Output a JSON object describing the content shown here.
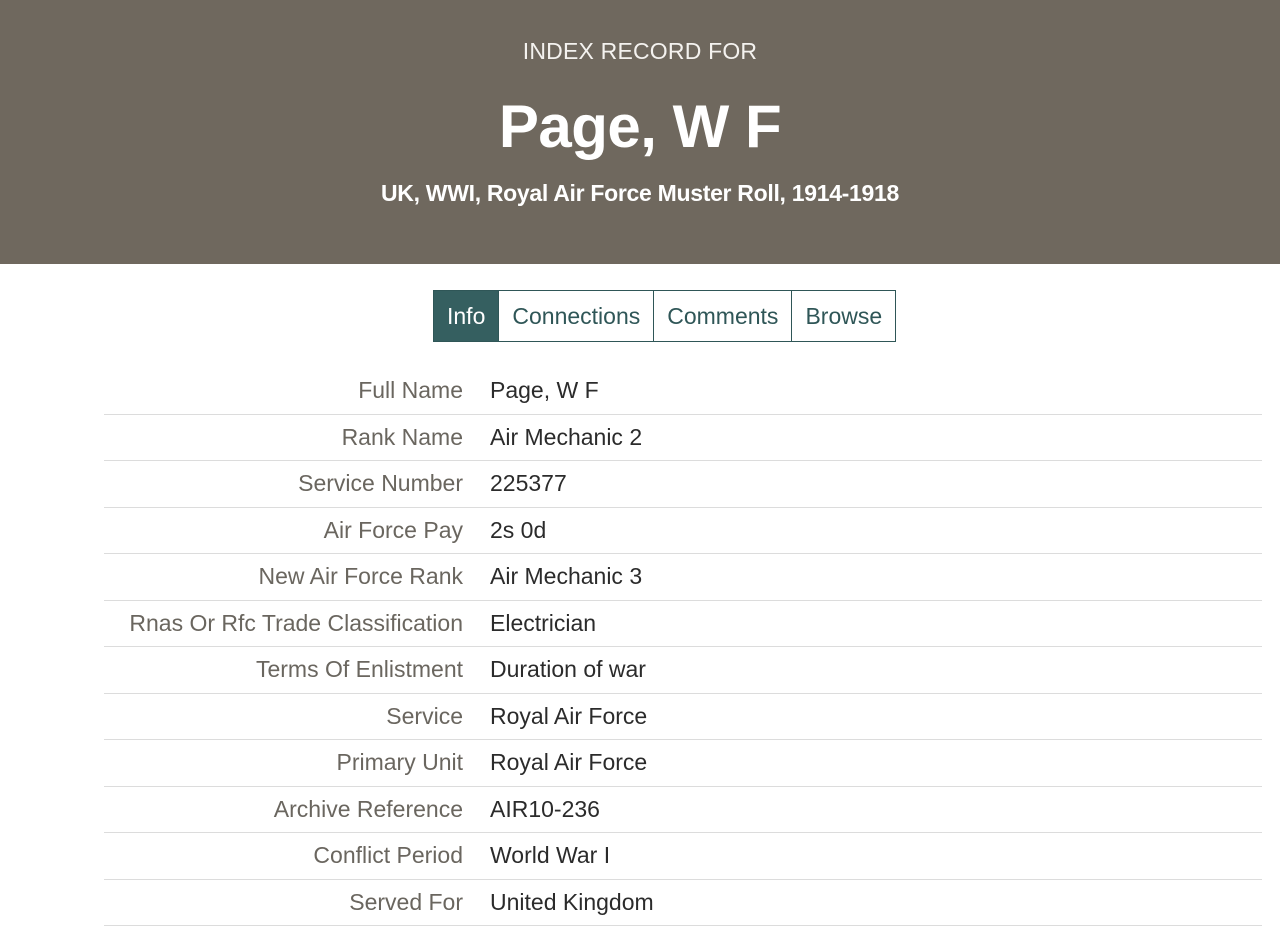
{
  "header": {
    "kicker": "INDEX RECORD FOR",
    "title": "Page, W F",
    "subtitle": "UK, WWI, Royal Air Force Muster Roll, 1914-1918"
  },
  "tabs": [
    {
      "label": "Info",
      "active": true
    },
    {
      "label": "Connections",
      "active": false
    },
    {
      "label": "Comments",
      "active": false
    },
    {
      "label": "Browse",
      "active": false
    }
  ],
  "record": [
    {
      "label": "Full Name",
      "value": "Page, W F"
    },
    {
      "label": "Rank Name",
      "value": "Air Mechanic 2"
    },
    {
      "label": "Service Number",
      "value": "225377"
    },
    {
      "label": "Air Force Pay",
      "value": "2s 0d"
    },
    {
      "label": "New Air Force Rank",
      "value": "Air Mechanic 3"
    },
    {
      "label": "Rnas Or Rfc Trade Classification",
      "value": "Electrician"
    },
    {
      "label": "Terms Of Enlistment",
      "value": "Duration of war"
    },
    {
      "label": "Service",
      "value": "Royal Air Force"
    },
    {
      "label": "Primary Unit",
      "value": "Royal Air Force"
    },
    {
      "label": "Archive Reference",
      "value": "AIR10-236"
    },
    {
      "label": "Conflict Period",
      "value": "World War I"
    },
    {
      "label": "Served For",
      "value": "United Kingdom"
    }
  ],
  "colors": {
    "header_bg": "#6f685e",
    "tab_accent": "#355f60",
    "label_text": "#6a665f",
    "value_text": "#2b2b2b"
  }
}
